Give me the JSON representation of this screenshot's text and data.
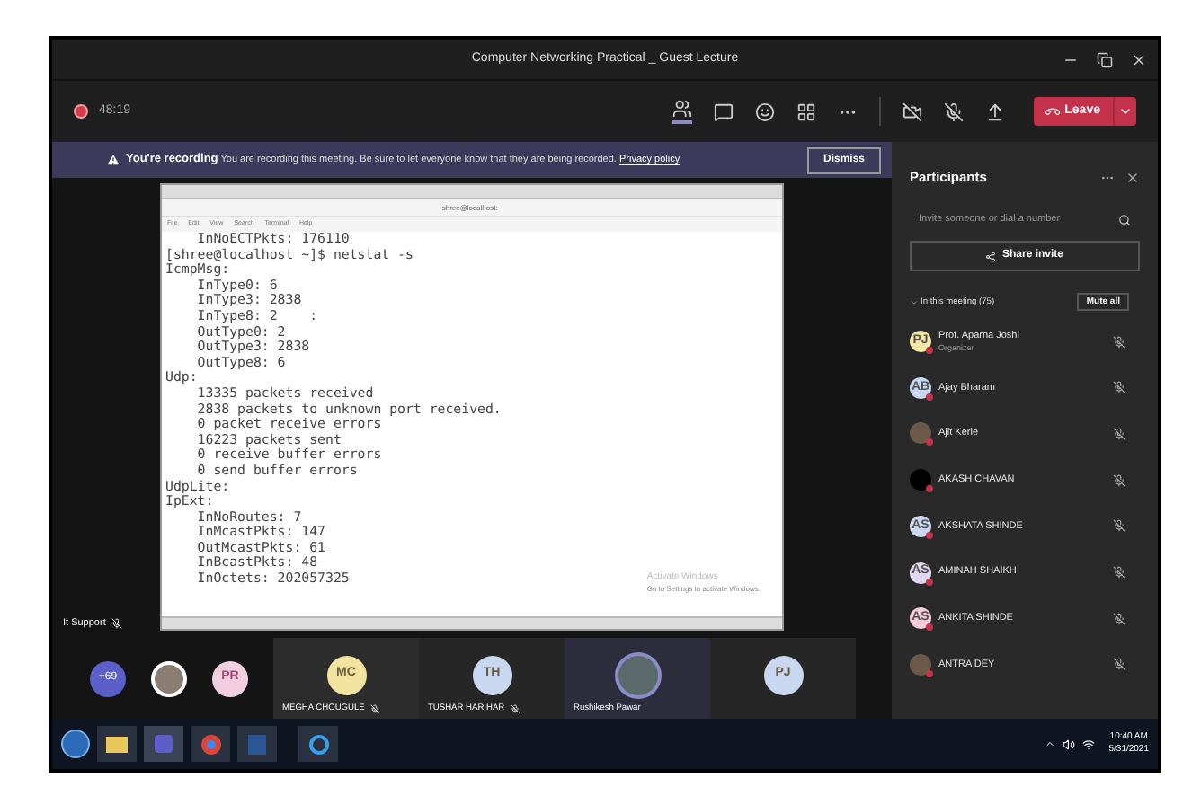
{
  "window": {
    "title": "Computer Networking Practical _ Guest Lecture"
  },
  "call_bar": {
    "timer": "48:19",
    "leave_label": "Leave"
  },
  "banner": {
    "title": "You're recording",
    "message": "You are recording this meeting. Be sure to let everyone know that they are being recorded.",
    "link": "Privacy policy",
    "dismiss": "Dismiss"
  },
  "shared_screen": {
    "presenter": "It Support",
    "terminal_title": "shree@localhost:~",
    "menu": [
      "File",
      "Edit",
      "View",
      "Search",
      "Terminal",
      "Help"
    ],
    "lines": [
      "    InNoECTPkts: 176110",
      "[shree@localhost ~]$ netstat -s",
      "IcmpMsg:",
      "    InType0: 6",
      "    InType3: 2838",
      "    InType8: 2    :",
      "    OutType0: 2",
      "    OutType3: 2838",
      "    OutType8: 6",
      "Udp:",
      "    13335 packets received",
      "    2838 packets to unknown port received.",
      "    0 packet receive errors",
      "    16223 packets sent",
      "    0 receive buffer errors",
      "    0 send buffer errors",
      "UdpLite:",
      "IpExt:",
      "    InNoRoutes: 7",
      "    InMcastPkts: 147",
      "    OutMcastPkts: 61",
      "    InBcastPkts: 48",
      "    InOctets: 202057325"
    ],
    "activation_title": "Activate Windows",
    "activation_hint": "Go to Settings to activate Windows."
  },
  "participants_panel": {
    "title": "Participants",
    "search": {
      "placeholder": "Invite someone or dial a number"
    },
    "share_invite": "Share invite",
    "section": "In this meeting (75)",
    "mute_all": "Mute all",
    "people": [
      {
        "kind": "initials",
        "initials": "PJ",
        "name": "Prof. Aparna Joshi",
        "role": "Organizer",
        "color": "#f5e7a8"
      },
      {
        "kind": "initials",
        "initials": "AB",
        "name": "Ajay Bharam",
        "color": "#c9d8f0"
      },
      {
        "kind": "photo",
        "name": "Ajit Kerle"
      },
      {
        "kind": "dark",
        "name": "AKASH CHAVAN"
      },
      {
        "kind": "initials",
        "initials": "AS",
        "name": "AKSHATA SHINDE",
        "color": "#c9d8f0"
      },
      {
        "kind": "initials",
        "initials": "AS",
        "name": "AMINAH SHAIKH",
        "color": "#e0d8f0"
      },
      {
        "kind": "initials",
        "initials": "AS",
        "name": "ANKITA SHINDE",
        "color": "#f5cbd8"
      },
      {
        "kind": "photo",
        "name": "ANTRA DEY"
      }
    ]
  },
  "gallery": {
    "overflow": "+69",
    "small": [
      {
        "kind": "photo"
      },
      {
        "kind": "initials",
        "initials": "PR"
      }
    ],
    "tiles": [
      {
        "kind": "initials",
        "initials": "MC",
        "name": "MEGHA CHOUGULE",
        "muted": true,
        "selected": false
      },
      {
        "kind": "initials",
        "initials": "TH",
        "name": "TUSHAR HARIHAR",
        "muted": true,
        "selected": false
      },
      {
        "kind": "photo",
        "name": "Rushikesh Pawar",
        "muted": false,
        "selected": true
      },
      {
        "kind": "initials",
        "initials": "PJ",
        "muted": false,
        "selected": false
      }
    ]
  },
  "taskbar": {
    "time": "10:40 AM",
    "date": "5/31/2021"
  }
}
